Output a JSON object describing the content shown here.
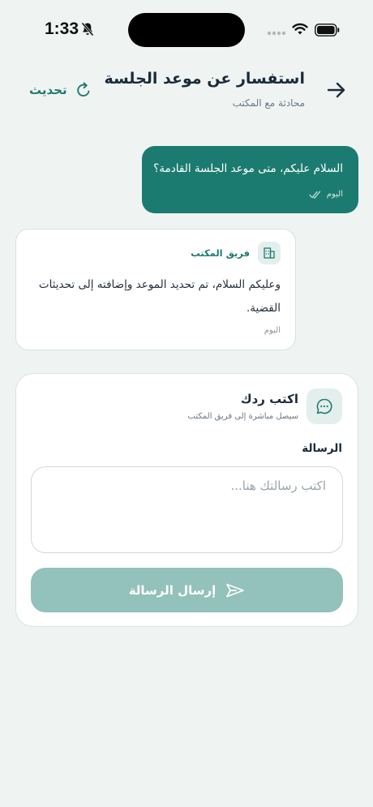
{
  "status_bar": {
    "time": "1:33"
  },
  "header": {
    "title": "استفسار عن موعد الجلسة",
    "subtitle": "محادثة مع المكتب",
    "refresh_label": "تحديث"
  },
  "messages": [
    {
      "direction": "sent",
      "text": "السلام عليكم، متى موعد الجلسة القادمة؟",
      "time": "اليوم"
    },
    {
      "direction": "received",
      "sender": "فريق المكتب",
      "text": "وعليكم السلام، تم تحديد الموعد وإضافته إلى تحديثات القضية.",
      "time": "اليوم"
    }
  ],
  "reply": {
    "title": "اكتب ردك",
    "subtitle": "سيصل مباشرة إلى فريق المكتب",
    "field_label": "الرسالة",
    "placeholder": "اكتب رسالتك هنا...",
    "value": "",
    "send_label": "إرسال الرسالة"
  },
  "colors": {
    "primary": "#1c7b70",
    "primary_disabled": "#93c1bb",
    "background": "#eff4f3",
    "accent_soft": "#e3efec"
  }
}
